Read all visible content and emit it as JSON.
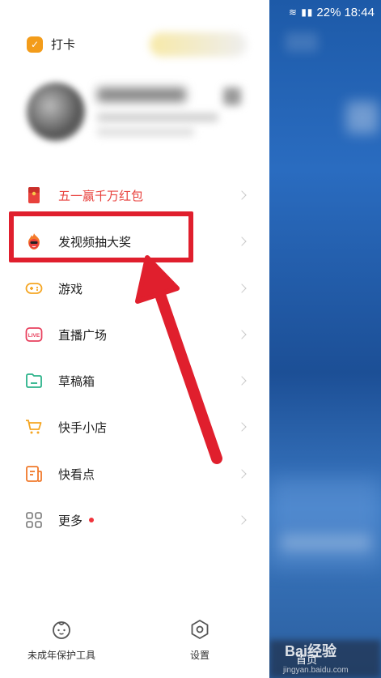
{
  "status_bar": {
    "battery": "22%",
    "time": "18:44",
    "signal_icons": "signal-icon"
  },
  "drawer": {
    "checkin": {
      "label": "打卡"
    },
    "menu": [
      {
        "label": "五一赢千万红包",
        "icon": "red-envelope-icon",
        "color": "#e8413c"
      },
      {
        "label": "发视频抽大奖",
        "icon": "fire-mascot-icon",
        "color": "#222222"
      },
      {
        "label": "游戏",
        "icon": "gamepad-icon",
        "color": "#222222"
      },
      {
        "label": "直播广场",
        "icon": "live-icon",
        "color": "#222222"
      },
      {
        "label": "草稿箱",
        "icon": "folder-icon",
        "color": "#222222"
      },
      {
        "label": "快手小店",
        "icon": "cart-icon",
        "color": "#222222"
      },
      {
        "label": "快看点",
        "icon": "news-icon",
        "color": "#222222"
      },
      {
        "label": "更多",
        "icon": "grid-icon",
        "color": "#222222",
        "badge": "red-dot"
      }
    ],
    "bottom": {
      "youth": {
        "label": "未成年保护工具",
        "icon": "baby-face-icon"
      },
      "settings": {
        "label": "设置",
        "icon": "gear-icon"
      }
    }
  },
  "background": {
    "home_tab": "首页",
    "watermark": "Bai经验",
    "watermark_sub": "jingyan.baidu.com"
  },
  "annotation": {
    "box_color": "#e01f2d",
    "arrow_color": "#e01f2d"
  }
}
